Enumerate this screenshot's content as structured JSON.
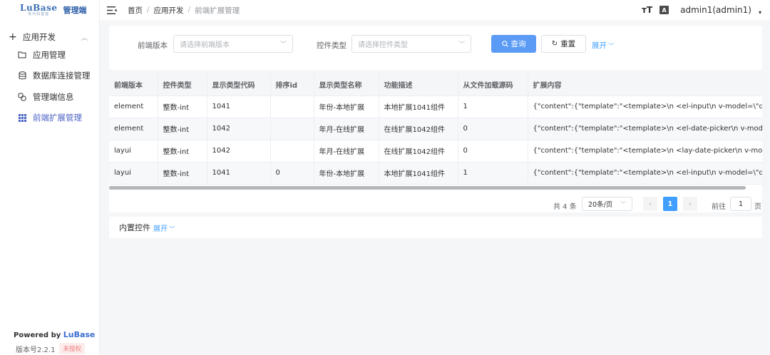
{
  "brand": {
    "logo_text": "LuBase",
    "logo_sub": "低代码基座",
    "title": "管理端"
  },
  "sidebar": {
    "group_label": "应用开发",
    "items": [
      {
        "label": "应用管理",
        "icon": "folder-icon"
      },
      {
        "label": "数据库连接管理",
        "icon": "database-icon"
      },
      {
        "label": "管理端信息",
        "icon": "link-icon"
      },
      {
        "label": "前端扩展管理",
        "icon": "grid-icon",
        "active": true
      }
    ],
    "powered_prefix": "Powered by ",
    "powered_brand": "LuBase",
    "version": "版本号2.2.1",
    "unauthorized": "未授权"
  },
  "header": {
    "breadcrumb": [
      "首页",
      "应用开发",
      "前端扩展管理"
    ],
    "font_icon": "тT",
    "translate_icon": "A",
    "user": "admin1(admin1)"
  },
  "search": {
    "version_label": "前端版本",
    "version_placeholder": "请选择前端版本",
    "type_label": "控件类型",
    "type_placeholder": "请选择控件类型",
    "query_label": "查询",
    "reset_label": "重置",
    "expand_label": "展开"
  },
  "table": {
    "columns": [
      "前端版本",
      "控件类型",
      "显示类型代码",
      "排序id",
      "显示类型名称",
      "功能描述",
      "从文件加载源码",
      "扩展内容"
    ],
    "rows": [
      [
        "element",
        "整数-int",
        "1041",
        "",
        "年份-本地扩展",
        "本地扩展1041组件",
        "1",
        "{\"content\":{\"template\":\"<template>\\n  <el-input\\n    v-model=\\\"query[key]\\\"\\n"
      ],
      [
        "element",
        "整数-int",
        "1042",
        "",
        "年月-在线扩展",
        "在线扩展1042组件",
        "0",
        "{\"content\":{\"template\":\"<template>\\n  <el-date-picker\\n    v-model=\\\"query[key]"
      ],
      [
        "layui",
        "整数-int",
        "1042",
        "",
        "年月-在线扩展",
        "在线扩展1042组件",
        "0",
        "{\"content\":{\"template\":\"<template>\\n  <lay-date-picker\\n    v-model=\\\"query"
      ],
      [
        "layui",
        "整数-int",
        "1041",
        "0",
        "年份-本地扩展",
        "本地扩展1041组件",
        "1",
        "{\"content\":{\"template\":\"<template>\\n  <el-input\\n    v-model=\\\"query[key]\\\"\\n"
      ]
    ]
  },
  "pagination": {
    "total": "共 4 条",
    "page_size": "20条/页",
    "prev": "‹",
    "current": "1",
    "next": "›",
    "goto_label": "前往",
    "goto_value": "1",
    "page_suffix": "页"
  },
  "builtin": {
    "title": "内置控件",
    "expand_label": "展开"
  },
  "colors": {
    "primary": "#409eff",
    "query_button": "#5b9bf5",
    "active_menu": "#4a63c5",
    "unauthorized_text": "#f07a7a"
  }
}
